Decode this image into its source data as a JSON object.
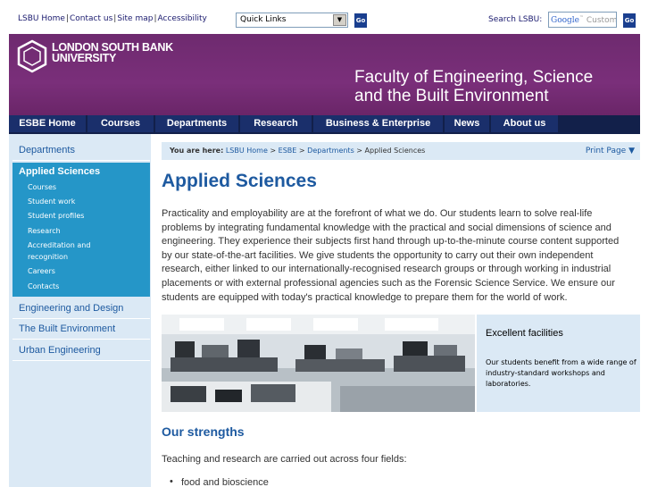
{
  "toplinks": {
    "items": [
      "LSBU Home",
      "Contact us",
      "Site map",
      "Accessibility"
    ]
  },
  "quicklinks": {
    "value": "Quick Links",
    "go": "Go"
  },
  "search": {
    "label": "Search LSBU:",
    "placeholder_brand": "Google",
    "placeholder_rest": "Custom",
    "go": "Go"
  },
  "banner": {
    "logo_line1": "LONDON SOUTH BANK",
    "logo_line2": "UNIVERSITY",
    "faculty_line1": "Faculty of Engineering, Science",
    "faculty_line2": "and the Built Environment",
    "color": "#7a2f7a"
  },
  "nav": {
    "items": [
      "ESBE Home",
      "Courses",
      "Departments",
      "Research",
      "Business & Enterprise",
      "News",
      "About us"
    ]
  },
  "sidebar": {
    "top": "Departments",
    "active": "Applied Sciences",
    "sub": [
      "Courses",
      "Student work",
      "Student profiles",
      "Research",
      "Accreditation and",
      "recognition",
      "Careers",
      "Contacts"
    ],
    "bottom": [
      "Engineering and Design",
      "The Built Environment",
      "Urban Engineering"
    ]
  },
  "breadcrumb": {
    "label": "You are here:",
    "crumbs": [
      "LSBU Home",
      "ESBE",
      "Departments"
    ],
    "sep": " > ",
    "current": "Applied Sciences",
    "print": "Print Page ▼"
  },
  "main": {
    "title": "Applied Sciences",
    "intro": "Practicality and employability are at the forefront of what we do. Our students learn to solve real-life problems by integrating fundamental knowledge with the practical and social dimensions of science and engineering. They experience their subjects first hand through up-to-the-minute course content supported by our state-of-the-art facilities. We give students the opportunity to carry out their own independent research, either linked to our internationally-recognised research groups or through working in industrial placements or with external professional agencies such as the Forensic Science Service. We ensure our students are equipped with today's practical knowledge to prepare them for the world of work.",
    "callout_title": "Excellent facilities",
    "callout_body": "Our students benefit from a wide range of industry-standard workshops and laboratories.",
    "strengths_title": "Our strengths",
    "strengths_intro": "Teaching and research are carried out across four fields:",
    "bullets": [
      "food and bioscience"
    ]
  },
  "colors": {
    "accent": "#1e5aa0",
    "nav": "#1a2f6b",
    "sidebar_bg": "#dbe9f5",
    "active": "#2596c8"
  }
}
